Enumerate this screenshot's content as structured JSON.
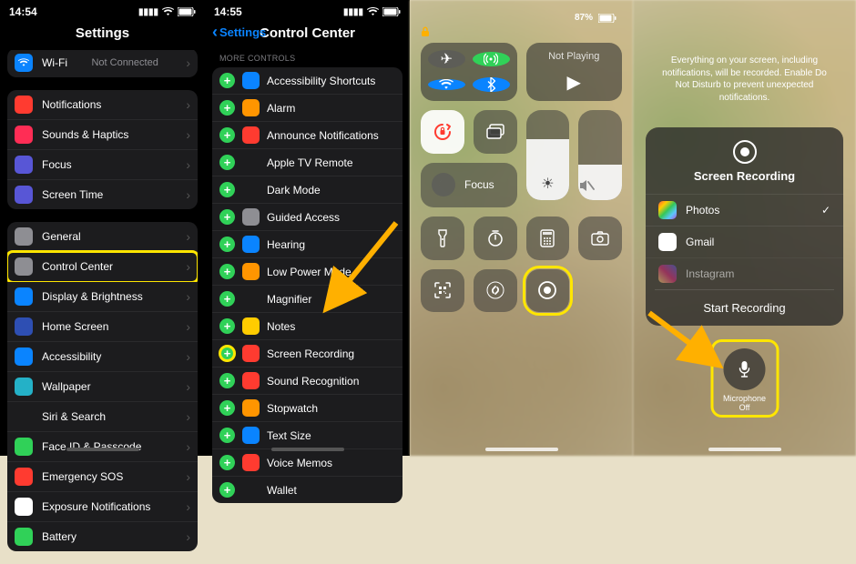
{
  "status": {
    "time1": "14:54",
    "time2": "14:55",
    "battery3": "87%"
  },
  "panel1": {
    "title": "Settings",
    "top_row": {
      "label": "Wi-Fi",
      "value": "Not Connected",
      "icon_color": "#0a84ff"
    },
    "group_a": [
      {
        "label": "Notifications",
        "icon": "bell",
        "color": "#ff3b30"
      },
      {
        "label": "Sounds & Haptics",
        "icon": "speaker",
        "color": "#ff2d55"
      },
      {
        "label": "Focus",
        "icon": "moon",
        "color": "#5856d6"
      },
      {
        "label": "Screen Time",
        "icon": "hourglass",
        "color": "#5856d6"
      }
    ],
    "group_b": [
      {
        "label": "General",
        "icon": "gear",
        "color": "#8e8e93"
      },
      {
        "label": "Control Center",
        "icon": "switches",
        "color": "#8e8e93",
        "highlight": true
      },
      {
        "label": "Display & Brightness",
        "icon": "text",
        "color": "#0a84ff"
      },
      {
        "label": "Home Screen",
        "icon": "grid",
        "color": "#2e4fb3"
      },
      {
        "label": "Accessibility",
        "icon": "person",
        "color": "#0a84ff"
      },
      {
        "label": "Wallpaper",
        "icon": "flower",
        "color": "#24b1c7"
      },
      {
        "label": "Siri & Search",
        "icon": "siri",
        "color": "#1c1c1e"
      },
      {
        "label": "Face ID & Passcode",
        "icon": "face",
        "color": "#30d158"
      },
      {
        "label": "Emergency SOS",
        "icon": "sos",
        "color": "#ff3b30"
      },
      {
        "label": "Exposure Notifications",
        "icon": "virus",
        "color": "#ffffff",
        "fg": "#ff3b30"
      },
      {
        "label": "Battery",
        "icon": "battery",
        "color": "#30d158"
      }
    ]
  },
  "panel2": {
    "back": "Settings",
    "title": "Control Center",
    "section_label": "MORE CONTROLS",
    "items": [
      {
        "label": "Accessibility Shortcuts",
        "color": "#0a84ff"
      },
      {
        "label": "Alarm",
        "color": "#ff9500"
      },
      {
        "label": "Announce Notifications",
        "color": "#ff3b30"
      },
      {
        "label": "Apple TV Remote",
        "color": "#1c1c1e"
      },
      {
        "label": "Dark Mode",
        "color": "#1c1c1e"
      },
      {
        "label": "Guided Access",
        "color": "#8e8e93"
      },
      {
        "label": "Hearing",
        "color": "#0a84ff"
      },
      {
        "label": "Low Power Mode",
        "color": "#ff9500"
      },
      {
        "label": "Magnifier",
        "color": "#1c1c1e"
      },
      {
        "label": "Notes",
        "color": "#ffcc00"
      },
      {
        "label": "Screen Recording",
        "color": "#ff3b30",
        "highlight": true
      },
      {
        "label": "Sound Recognition",
        "color": "#ff3b30"
      },
      {
        "label": "Stopwatch",
        "color": "#ff9500"
      },
      {
        "label": "Text Size",
        "color": "#0a84ff"
      },
      {
        "label": "Voice Memos",
        "color": "#ff3b30"
      },
      {
        "label": "Wallet",
        "color": "#1c1c1e"
      }
    ]
  },
  "panel3": {
    "not_playing": "Not Playing",
    "focus": "Focus",
    "brightness_pct": 68,
    "volume_pct": 40
  },
  "panel4": {
    "notice": "Everything on your screen, including notifications, will be recorded. Enable Do Not Disturb to prevent unexpected notifications.",
    "sheet_title": "Screen Recording",
    "apps": [
      {
        "label": "Photos",
        "color": "linear-gradient(135deg,#ff5e3a,#ffcc00,#34c759,#5ac8fa,#af52de)",
        "checked": true
      },
      {
        "label": "Gmail",
        "color": "#ffffff"
      },
      {
        "label": "Instagram",
        "color": "linear-gradient(45deg,#feda75,#d62976,#4f5bd5)"
      }
    ],
    "start": "Start Recording",
    "mic_label_1": "Microphone",
    "mic_label_2": "Off"
  }
}
